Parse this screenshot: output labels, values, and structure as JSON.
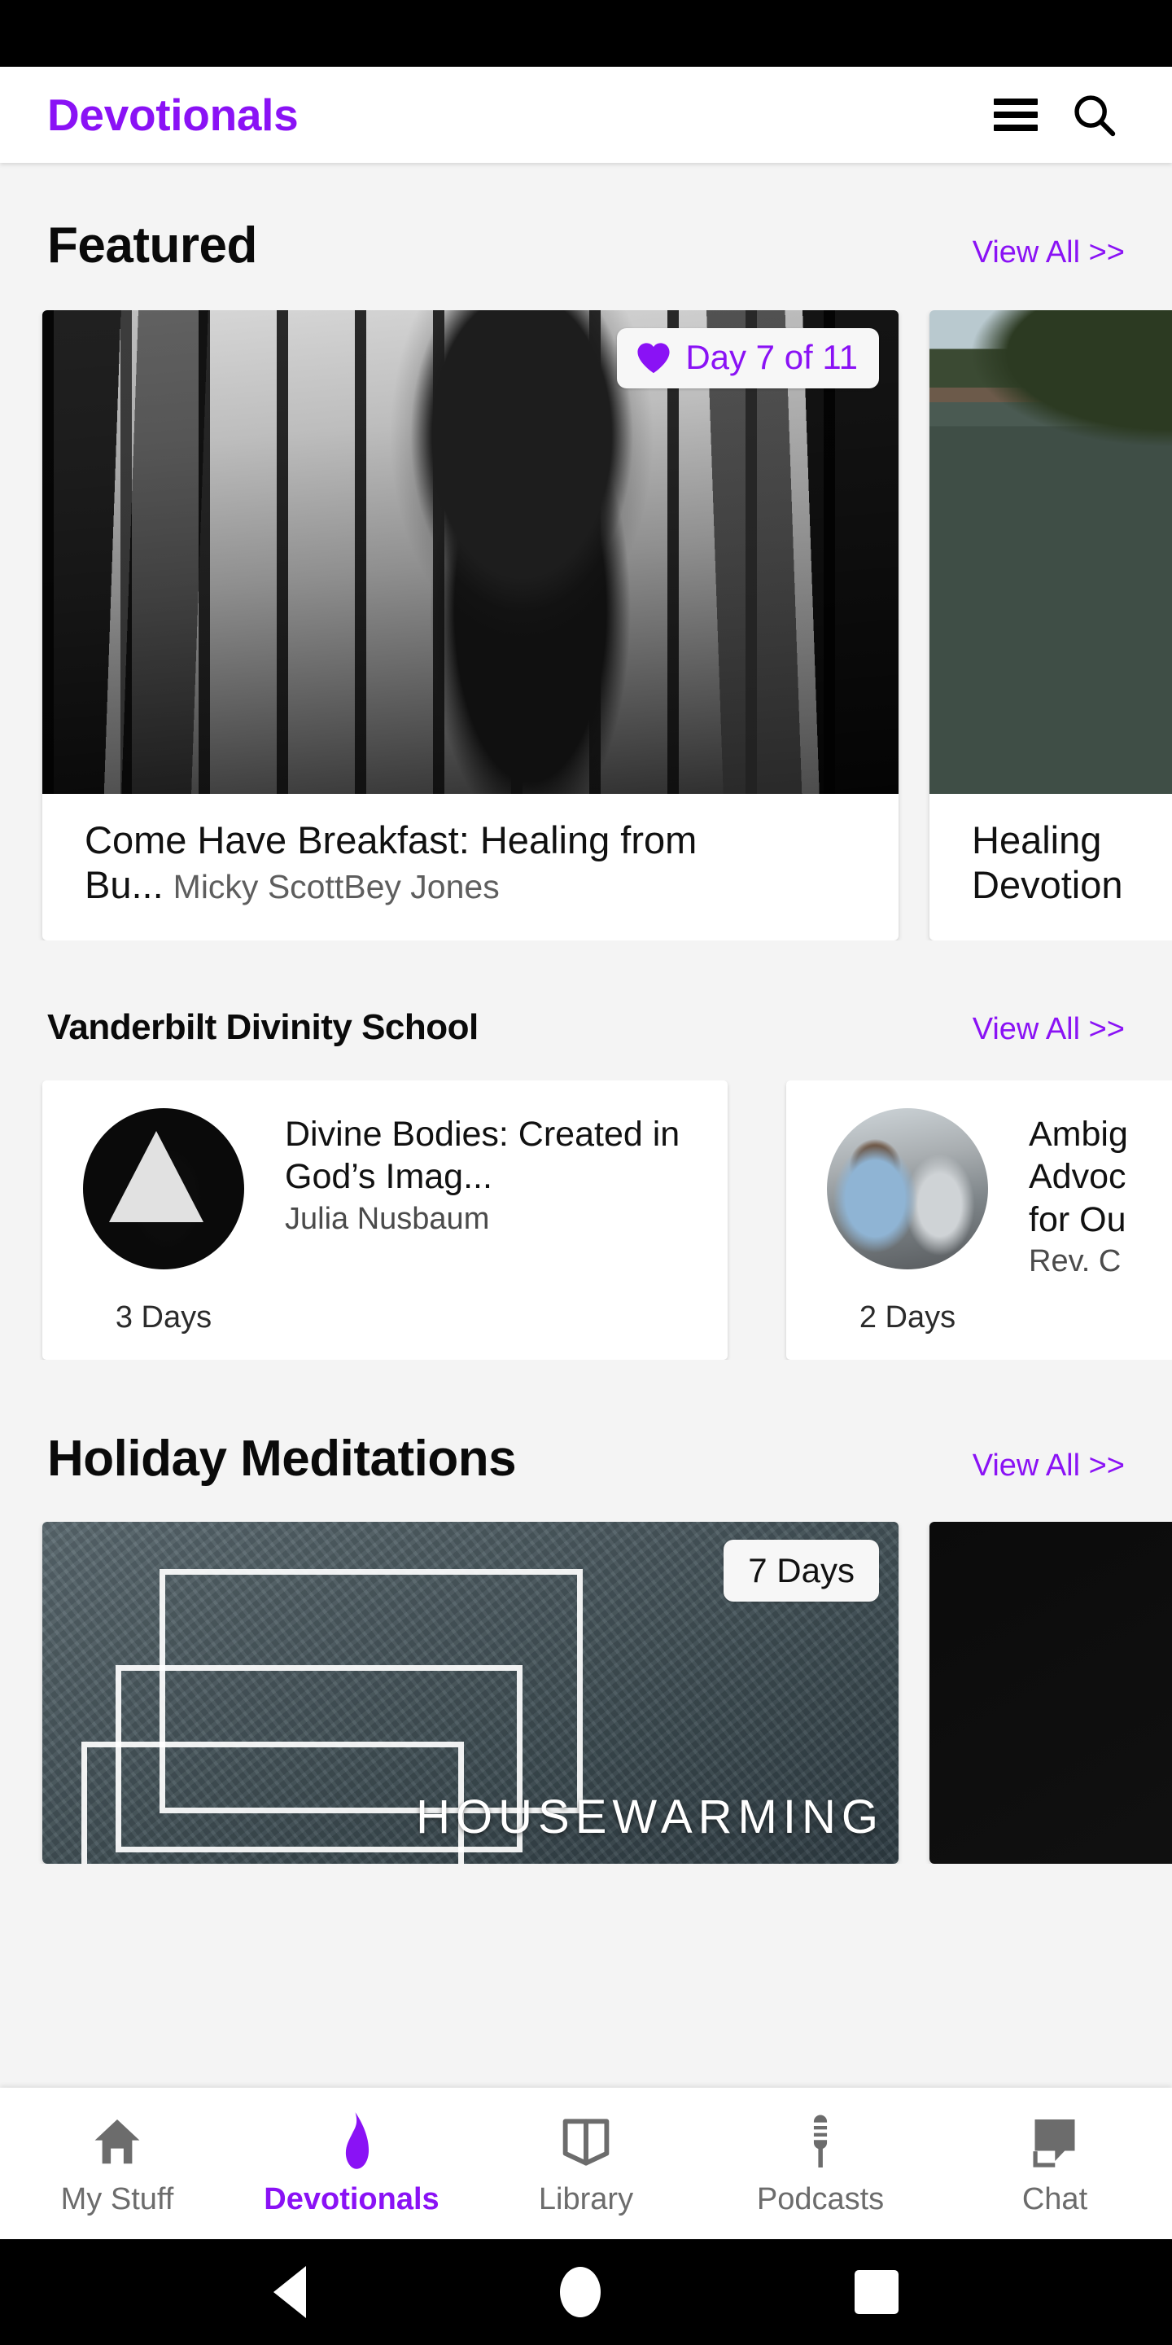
{
  "accent_color": "#8a12f5",
  "app_bar": {
    "title": "Devotionals",
    "menu_icon": "hamburger-menu-icon",
    "search_icon": "search-icon"
  },
  "sections": [
    {
      "id": "featured",
      "title": "Featured",
      "view_all": "View All >>",
      "cards": [
        {
          "badge": "Day 7 of 11",
          "badge_icon": "heart-icon",
          "title": "Come Have Breakfast: Healing from Bu...",
          "author": "Micky ScottBey Jones",
          "image": "black-and-white-woman-on-balcony"
        },
        {
          "title_line1": "Healing",
          "title_line2": "Devotion",
          "image": "lake-shoreline-photo"
        }
      ]
    },
    {
      "id": "vanderbilt",
      "title": "Vanderbilt Divinity School",
      "view_all": "View All >>",
      "cards": [
        {
          "title": "Divine Bodies: Created in God’s Imag...",
          "author": "Julia Nusbaum",
          "duration": "3 Days",
          "image": "triangle-light-portrait"
        },
        {
          "title_line1": "Ambig",
          "title_line2": "Advoc",
          "title_line3": "for Ou",
          "author": "Rev. C",
          "duration": "2 Days",
          "image": "street-portrait"
        }
      ]
    },
    {
      "id": "holiday",
      "title": "Holiday Meditations",
      "view_all": "View All >>",
      "cards": [
        {
          "badge": "7 Days",
          "overlay_text": "HOUSEWARMING",
          "image": "concrete-wall-housewarming"
        },
        {
          "image": "dark-figure-photo"
        }
      ]
    }
  ],
  "tabs": [
    {
      "label": "My Stuff",
      "icon": "home-icon",
      "active": false
    },
    {
      "label": "Devotionals",
      "icon": "flame-icon",
      "active": true
    },
    {
      "label": "Library",
      "icon": "open-book-icon",
      "active": false
    },
    {
      "label": "Podcasts",
      "icon": "microphone-icon",
      "active": false
    },
    {
      "label": "Chat",
      "icon": "chat-bubble-icon",
      "active": false
    }
  ],
  "system_nav": {
    "back": "back-button",
    "home": "home-button",
    "recents": "recents-button"
  }
}
